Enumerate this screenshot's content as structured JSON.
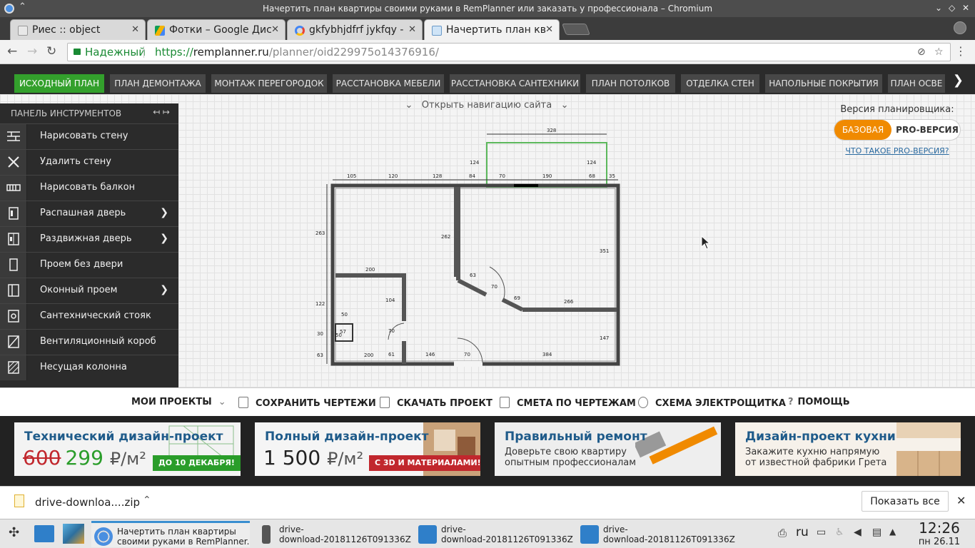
{
  "window": {
    "title": "Начертить план квартиры своими руками в RemPlanner или заказать у профессионала – Chromium"
  },
  "tabs": [
    {
      "label": "Риес :: object",
      "active": false
    },
    {
      "label": "Фотки – Google Дис",
      "active": false
    },
    {
      "label": "gkfybhjdfrf jykfqy -",
      "active": false
    },
    {
      "label": "Начертить план кв",
      "active": true
    }
  ],
  "address": {
    "secure_label": "Надежный",
    "scheme": "https://",
    "host": "remplanner.ru",
    "path": "/planner/oid229975o14376916/"
  },
  "app_nav": {
    "items": [
      "ИСХОДНЫЙ ПЛАН",
      "ПЛАН ДЕМОНТАЖА",
      "МОНТАЖ ПЕРЕГОРОДОК",
      "РАССТАНОВКА МЕБЕЛИ",
      "РАССТАНОВКА САНТЕХНИКИ",
      "ПЛАН ПОТОЛКОВ",
      "ОТДЕЛКА СТЕН",
      "НАПОЛЬНЫЕ ПОКРЫТИЯ",
      "ПЛАН ОСВЕ"
    ],
    "active_index": 0,
    "accent": "#33a02c"
  },
  "site_nav": {
    "label": "Открыть навигацию сайта"
  },
  "version": {
    "label": "Версия планировщика:",
    "basic": "БАЗОВАЯ",
    "pro": "PRO-ВЕРСИЯ",
    "link": "ЧТО ТАКОЕ PRO-ВЕРСИЯ?",
    "accent": "#f08a00"
  },
  "tools": {
    "header": "ПАНЕЛЬ ИНСТРУМЕНТОВ",
    "items": [
      {
        "label": "Нарисовать стену",
        "icon": "brick-wall-icon",
        "submenu": false
      },
      {
        "label": "Удалить стену",
        "icon": "delete-wall-icon",
        "submenu": false
      },
      {
        "label": "Нарисовать балкон",
        "icon": "balcony-icon",
        "submenu": false
      },
      {
        "label": "Распашная дверь",
        "icon": "swing-door-icon",
        "submenu": true
      },
      {
        "label": "Раздвижная дверь",
        "icon": "sliding-door-icon",
        "submenu": true
      },
      {
        "label": "Проем без двери",
        "icon": "doorway-icon",
        "submenu": false
      },
      {
        "label": "Оконный проем",
        "icon": "window-icon",
        "submenu": true
      },
      {
        "label": "Сантехнический стояк",
        "icon": "plumbing-riser-icon",
        "submenu": false
      },
      {
        "label": "Вентиляционный короб",
        "icon": "vent-duct-icon",
        "submenu": false
      },
      {
        "label": "Несущая колонна",
        "icon": "column-icon",
        "submenu": false
      }
    ]
  },
  "plan_dims": [
    "328",
    "124",
    "124",
    "105",
    "120",
    "128",
    "84",
    "70",
    "190",
    "68",
    "35",
    "263",
    "262",
    "351",
    "200",
    "63",
    "70",
    "69",
    "266",
    "122",
    "104",
    "50",
    "70",
    "30",
    "50",
    "147",
    "63",
    "200",
    "61",
    "146",
    "70",
    "384",
    "57"
  ],
  "bottom_bar": {
    "my_projects": "МОИ ПРОЕКТЫ",
    "save": "СОХРАНИТЬ ЧЕРТЕЖИ",
    "download": "СКАЧАТЬ ПРОЕКТ",
    "estimate": "СМЕТА ПО ЧЕРТЕЖАМ",
    "electric": "СХЕМА ЭЛЕКТРОЩИТКА",
    "help": "ПОМОЩЬ"
  },
  "banners": [
    {
      "title": "Технический дизайн-проект",
      "old_price": "600",
      "new_price": "299",
      "unit": "₽/м²",
      "badge": "ДО 10 ДЕКАБРЯ!"
    },
    {
      "title": "Полный дизайн-проект",
      "price": "1 500",
      "unit": "₽/м²",
      "badge": "С 3D И МАТЕРИАЛАМИ!"
    },
    {
      "title": "Правильный ремонт",
      "line1": "Доверьте свою квартиру",
      "line2": "опытным профессионалам"
    },
    {
      "title": "Дизайн-проект кухни",
      "line1": "Закажите кухню напрямую",
      "line2": "от известной фабрики Грета"
    }
  ],
  "download_bar": {
    "file": "drive-downloa....zip",
    "show_all": "Показать все"
  },
  "taskbar": {
    "items": [
      {
        "line1": "Начертить план квартиры",
        "line2": "своими руками в RemPlanner..."
      },
      {
        "line1": "drive-",
        "line2": "download-20181126T091336Z..."
      },
      {
        "line1": "drive-",
        "line2": "download-20181126T091336Z..."
      },
      {
        "line1": "drive-",
        "line2": "download-20181126T091336Z..."
      }
    ],
    "lang": "ru",
    "time": "12:26",
    "date": "пн 26.11"
  }
}
